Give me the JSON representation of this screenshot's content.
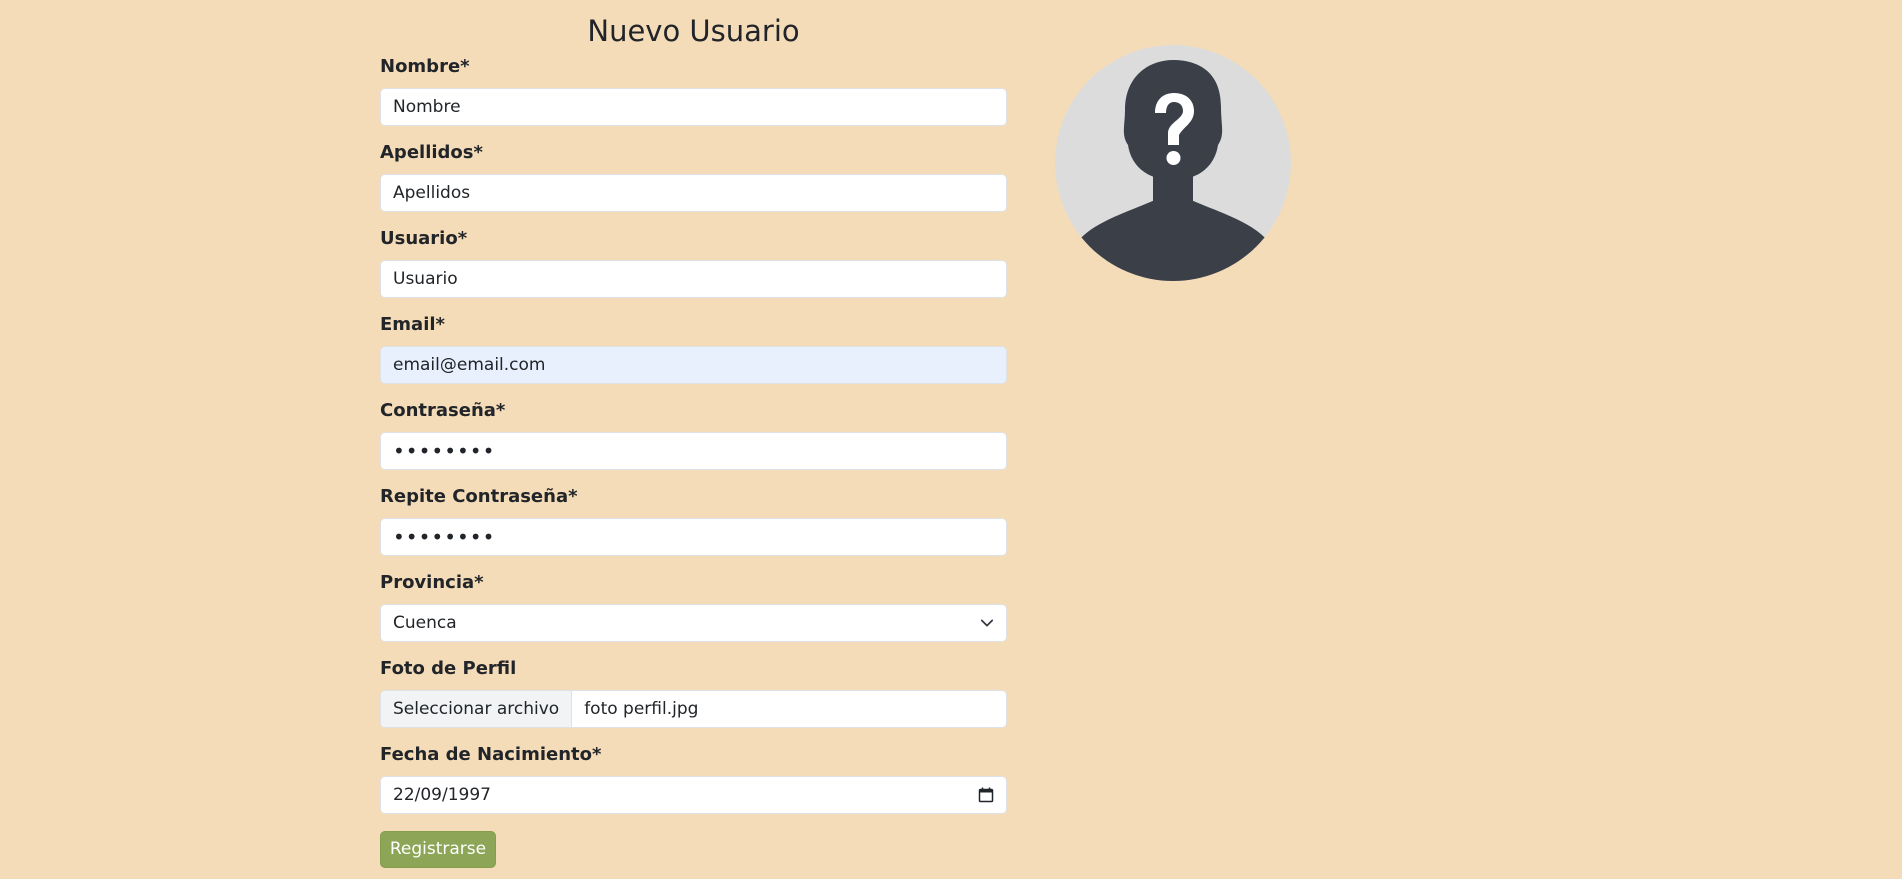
{
  "page_title": "Nuevo Usuario",
  "form": {
    "nombre": {
      "label": "Nombre*",
      "value": "Nombre"
    },
    "apellidos": {
      "label": "Apellidos*",
      "value": "Apellidos"
    },
    "usuario": {
      "label": "Usuario*",
      "value": "Usuario"
    },
    "email": {
      "label": "Email*",
      "value": "email@email.com"
    },
    "contrasena": {
      "label": "Contraseña*",
      "value": "••••••••"
    },
    "repite_contrasena": {
      "label": "Repite Contraseña*",
      "value": "••••••••"
    },
    "provincia": {
      "label": "Provincia*",
      "selected": "Cuenca"
    },
    "foto": {
      "label": "Foto de Perfil",
      "button_label": "Seleccionar archivo",
      "file_name": "foto perfil.jpg"
    },
    "fecha_nacimiento": {
      "label": "Fecha de Nacimiento*",
      "value": "22/09/1997"
    },
    "submit_label": "Registrarse"
  },
  "avatar": {
    "icon": "unknown-user-icon"
  },
  "colors": {
    "background": "#f5dcb8",
    "submit_button": "#8da556",
    "autofill_bg": "#e8f0fe",
    "avatar_bg": "#dcdcdc",
    "avatar_fg": "#3b4048"
  }
}
